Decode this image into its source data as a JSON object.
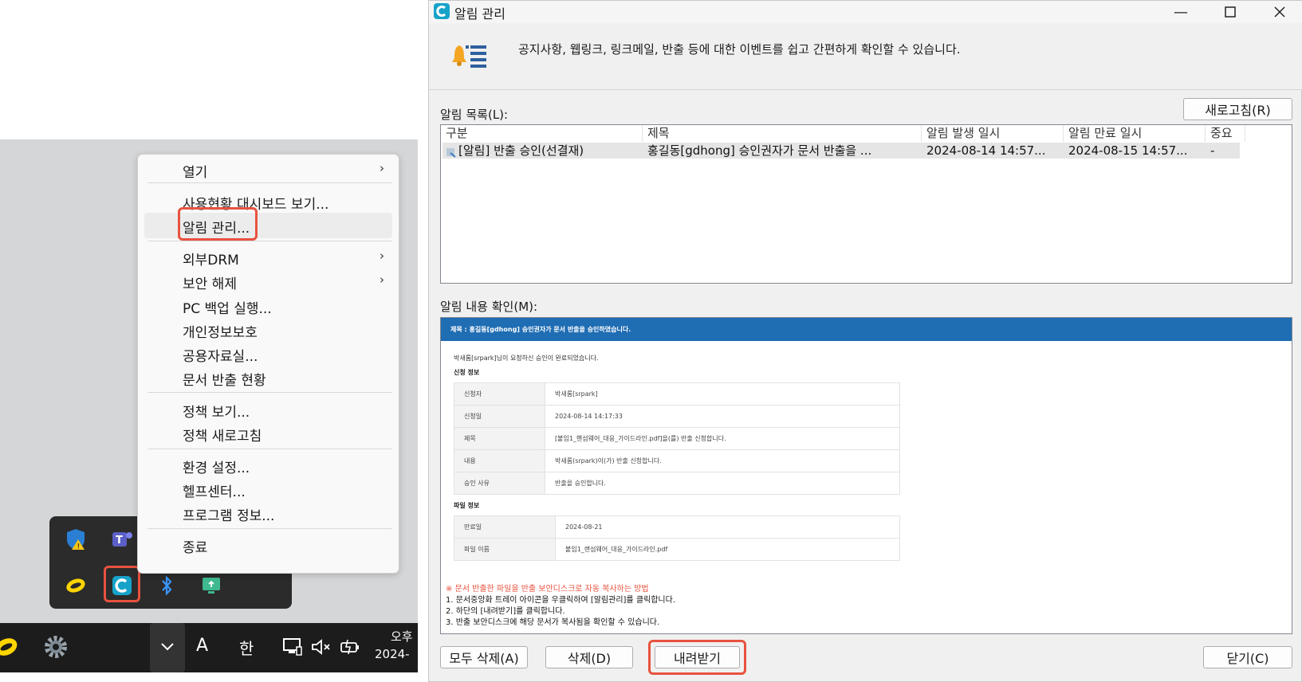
{
  "context_menu": {
    "items": [
      {
        "label": "열기",
        "submenu": true
      },
      {
        "label": "사용현황 대시보드 보기..."
      },
      {
        "label": "알림 관리..."
      },
      {
        "label": "외부DRM",
        "submenu": true
      },
      {
        "label": "보안 해제",
        "submenu": true
      },
      {
        "label": "PC 백업 실행..."
      },
      {
        "label": "개인정보보호"
      },
      {
        "label": "공용자료실..."
      },
      {
        "label": "문서 반출 현황"
      },
      {
        "label": "정책 보기..."
      },
      {
        "label": "정책 새로고침"
      },
      {
        "label": "환경 설정..."
      },
      {
        "label": "헬프센터..."
      },
      {
        "label": "프로그램 정보..."
      },
      {
        "label": "종료"
      }
    ]
  },
  "taskbar": {
    "ime_a": "A",
    "ime_han": "한",
    "clock_line1": "오후",
    "clock_line2": "2024-"
  },
  "tray_icons": [
    "defender-warning-icon",
    "teams-icon",
    "messenger-icon",
    "app-c-icon",
    "bluetooth-icon",
    "screen-share-icon"
  ],
  "window": {
    "title": "알림 관리",
    "description": "공지사항, 웹링크, 링크메일, 반출 등에 대한 이벤트를 쉽고 간편하게 확인할 수 있습니다.",
    "list_label": "알림 목록(L):",
    "refresh_button": "새로고침(R)",
    "columns": [
      "구분",
      "제목",
      "알림 발생 일시",
      "알림 만료 일시",
      "중요"
    ],
    "rows": [
      {
        "type": "[알림] 반출 승인(선결재)",
        "subject": "홍길동[gdhong] 승인권자가 문서 반출을 ...",
        "created": "2024-08-14 14:57...",
        "expires": "2024-08-15 14:57...",
        "important": "-"
      }
    ],
    "content_label": "알림 내용 확인(M):",
    "content": {
      "header": "제목 : 홍길동[gdhong] 승인권자가 문서 반출을 승인하였습니다.",
      "intro": "박새롬[srpark]님이 요청하신 승인이 완료되었습니다.",
      "request_section": "신청 정보",
      "request_rows": [
        {
          "key": "신청자",
          "value": "박새롬[srpark]"
        },
        {
          "key": "신청일",
          "value": "2024-08-14 14:17:33"
        },
        {
          "key": "제목",
          "value": "[붙임1_핸섬웨어_대응_가이드라인.pdf]을(를) 반출 신청합니다."
        },
        {
          "key": "내용",
          "value": "박새롬(srpark)이(가) 반출 신청합니다."
        },
        {
          "key": "승인 사유",
          "value": "반출을 승인합니다."
        }
      ],
      "file_section": "파일 정보",
      "file_rows": [
        {
          "key": "만료일",
          "value": "2024-08-21"
        },
        {
          "key": "파일 이름",
          "value": "붙임1_랜섬웨어_대응_가이드라인.pdf"
        }
      ],
      "note_title": "※ 문서 반출한 파일을 반출 보안디스크로 자동 복사하는 방법",
      "note_lines": [
        "1. 문서중앙화 트레이 아이콘을 우클릭하여 [알림관리]를 클릭합니다.",
        "2. 하단의 [내려받기]를 클릭합니다.",
        "3. 반출 보안디스크에 해당 문서가 복사됨을 확인할 수 있습니다."
      ]
    },
    "buttons": {
      "delete_all": "모두 삭제(A)",
      "delete": "삭제(D)",
      "download": "내려받기",
      "close": "닫기(C)"
    }
  },
  "colors": {
    "highlight": "#e8523f",
    "header_blue": "#1f6db3",
    "app_icon": "#17a3c9",
    "note_red": "#e8523f"
  }
}
